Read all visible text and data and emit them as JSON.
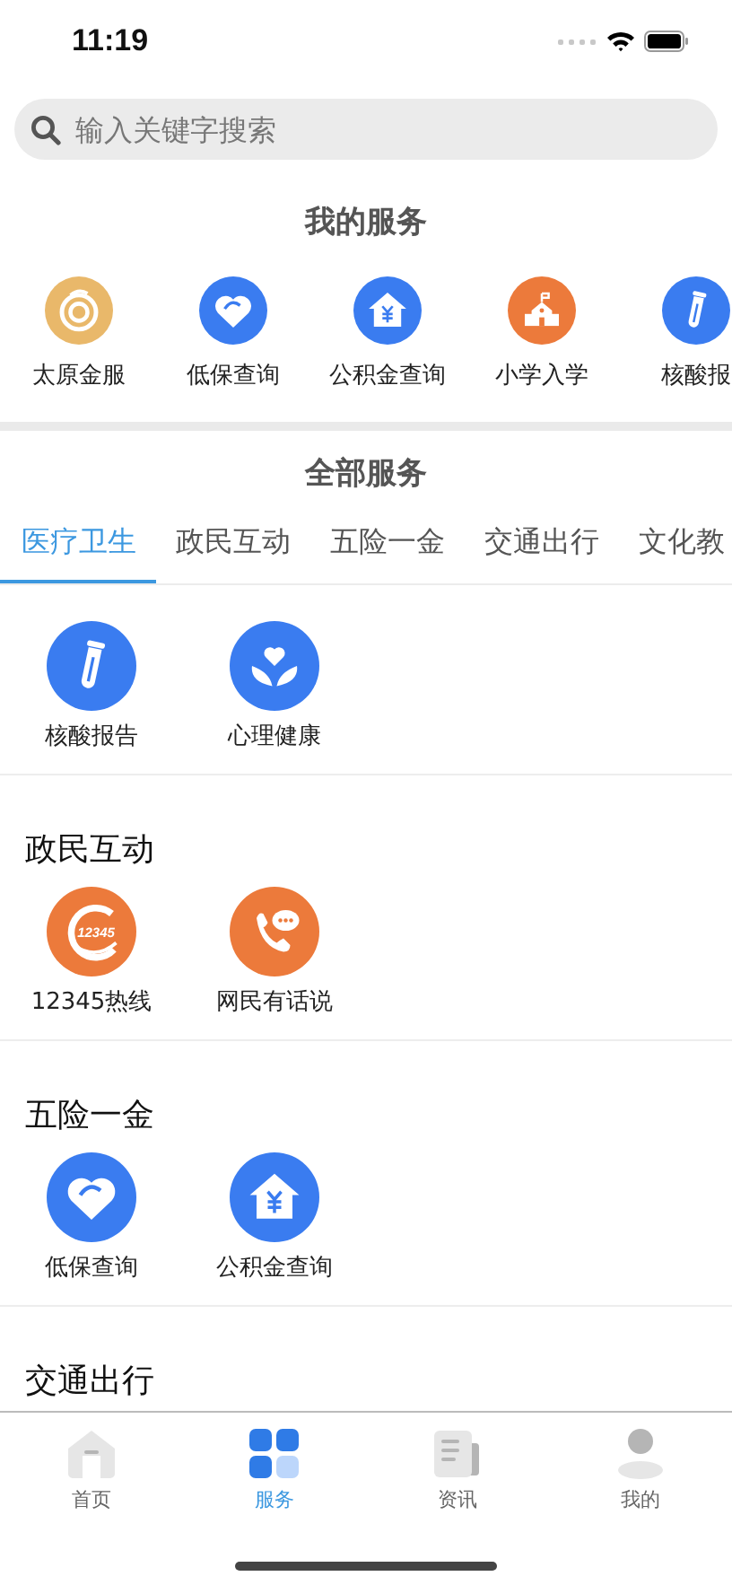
{
  "status_bar": {
    "time": "11:19"
  },
  "search": {
    "placeholder": "输入关键字搜索"
  },
  "my_services": {
    "title": "我的服务",
    "items": [
      {
        "label": "太原金服",
        "kind": "coin"
      },
      {
        "label": "低保查询",
        "kind": "heart"
      },
      {
        "label": "公积金查询",
        "kind": "house"
      },
      {
        "label": "小学入学",
        "kind": "school"
      },
      {
        "label": "核酸报",
        "kind": "tube"
      }
    ]
  },
  "all_services": {
    "title": "全部服务",
    "tabs": [
      {
        "label": "医疗卫生",
        "selected": true
      },
      {
        "label": "政民互动",
        "selected": false
      },
      {
        "label": "五险一金",
        "selected": false
      },
      {
        "label": "交通出行",
        "selected": false
      },
      {
        "label": "文化教",
        "selected": false
      }
    ],
    "sections": [
      {
        "items": [
          {
            "label": "核酸报告",
            "kind": "tube"
          },
          {
            "label": "心理健康",
            "kind": "hands"
          }
        ]
      },
      {
        "title": "政民互动",
        "items": [
          {
            "label": "12345热线",
            "kind": "hotline",
            "logo_text": "12345"
          },
          {
            "label": "网民有话说",
            "kind": "phone"
          }
        ]
      },
      {
        "title": "五险一金",
        "items": [
          {
            "label": "低保查询",
            "kind": "heart"
          },
          {
            "label": "公积金查询",
            "kind": "house"
          }
        ]
      },
      {
        "title": "交通出行"
      }
    ]
  },
  "tab_bar": [
    {
      "label": "首页",
      "kind": "home",
      "selected": false
    },
    {
      "label": "服务",
      "kind": "grid",
      "selected": true
    },
    {
      "label": "资讯",
      "kind": "news",
      "selected": false
    },
    {
      "label": "我的",
      "kind": "person",
      "selected": false
    }
  ]
}
